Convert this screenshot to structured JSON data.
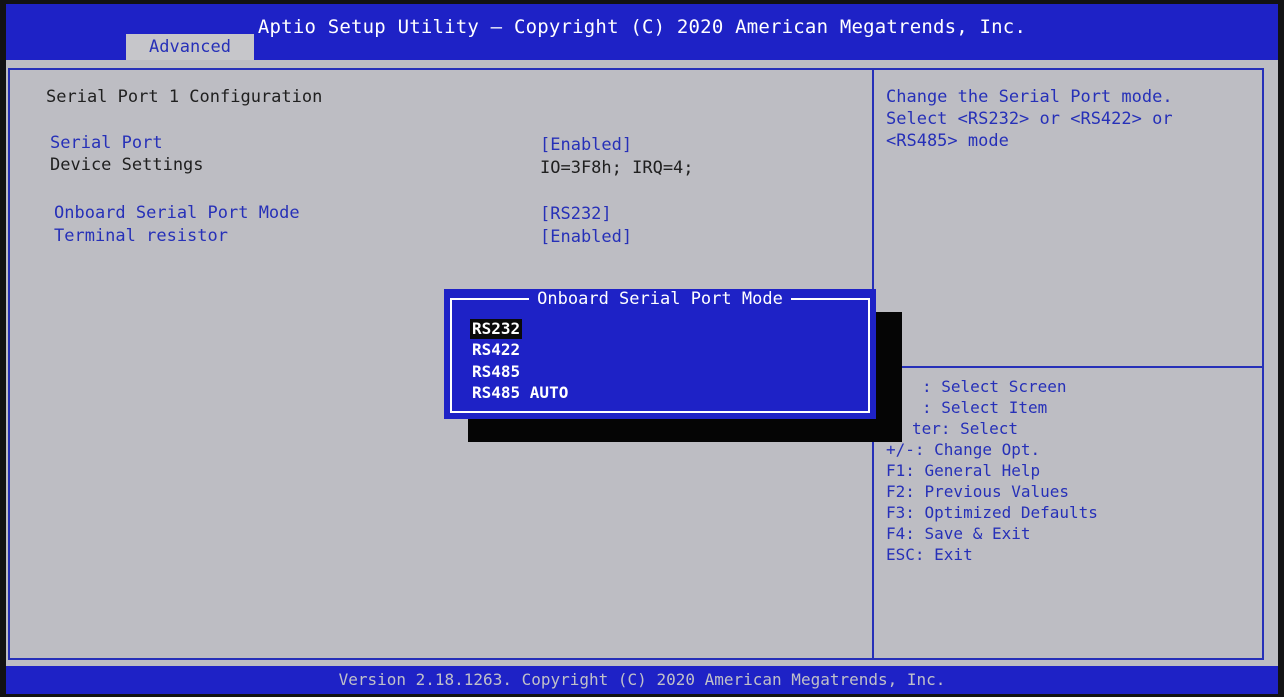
{
  "header": {
    "title": "Aptio Setup Utility – Copyright (C) 2020 American Megatrends, Inc.",
    "active_tab": "Advanced"
  },
  "main": {
    "section_title": "Serial Port 1 Configuration",
    "items": [
      {
        "label": "Serial Port",
        "value": "[Enabled]"
      },
      {
        "label": "Device Settings",
        "value": "IO=3F8h; IRQ=4;"
      },
      {
        "label": "Onboard Serial Port Mode",
        "value": "[RS232]"
      },
      {
        "label": "Terminal resistor",
        "value": "[Enabled]"
      }
    ]
  },
  "help": {
    "lines": [
      "Change the Serial Port mode.",
      "Select <RS232> or <RS422> or",
      "<RS485> mode"
    ]
  },
  "keys": [
    ": Select Screen",
    ": Select Item",
    "ter: Select",
    "+/-: Change Opt.",
    "F1: General Help",
    "F2: Previous Values",
    "F3: Optimized Defaults",
    "F4: Save & Exit",
    "ESC: Exit"
  ],
  "popup": {
    "title": "Onboard Serial Port Mode",
    "selected": "RS232",
    "options": [
      "RS232",
      "RS422",
      "RS485",
      "RS485 AUTO"
    ]
  },
  "footer": {
    "version": "Version 2.18.1263. Copyright (C) 2020 American Megatrends, Inc."
  },
  "colors": {
    "bios_blue": "#1e22c6",
    "panel_gray": "#bdbdc3",
    "item_blue": "#2630b8"
  }
}
